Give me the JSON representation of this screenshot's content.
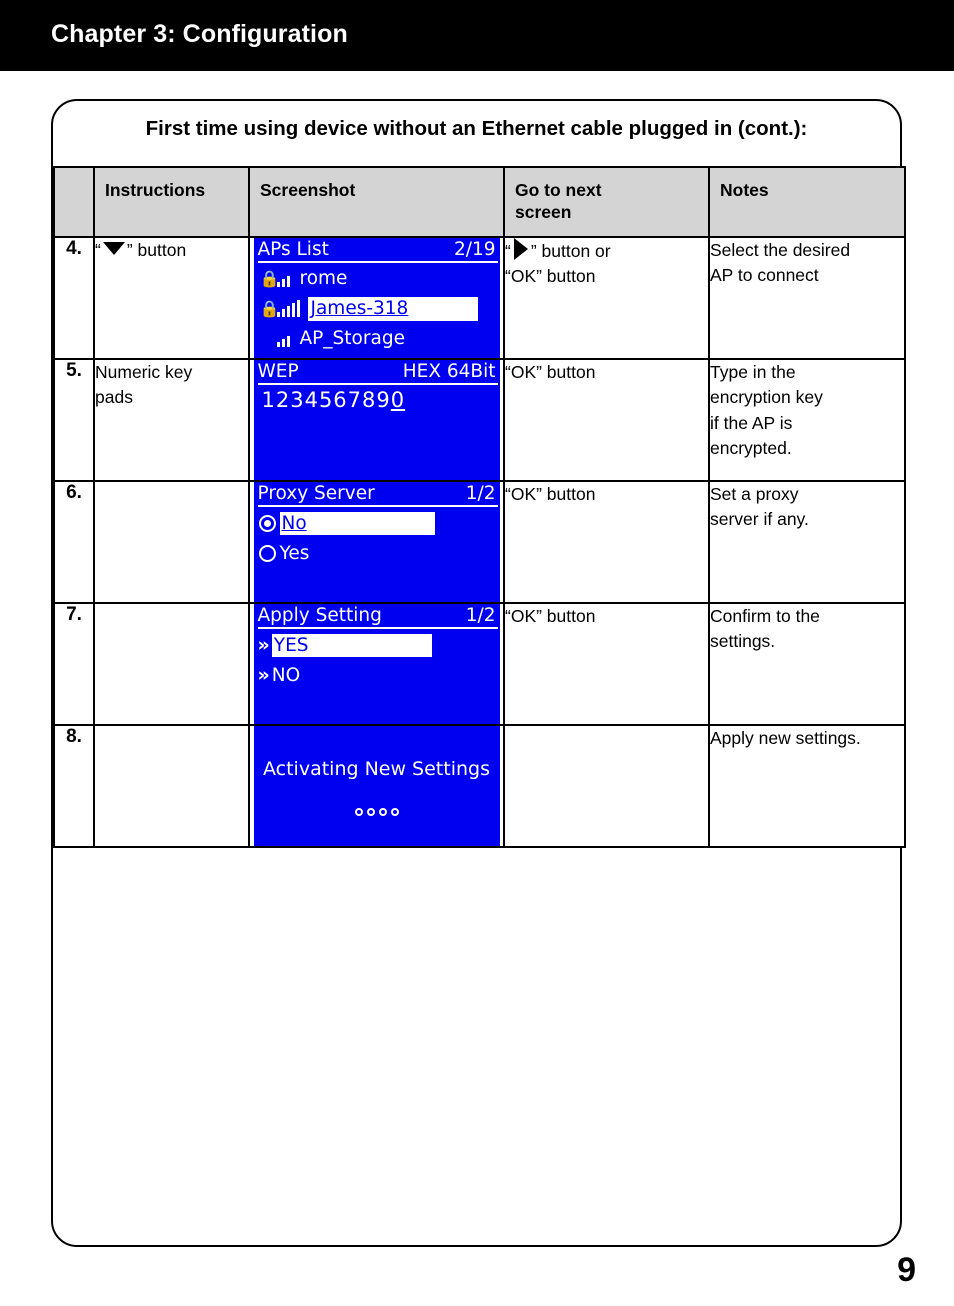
{
  "header": {
    "chapter_title": "Chapter 3: Configuration",
    "bar_color": "#000000"
  },
  "panel": {
    "heading": "First time using device without an Ethernet cable plugged in (cont.):"
  },
  "table": {
    "columns": [
      "",
      "Instructions",
      "Screenshot",
      "Go to next screen",
      "Notes"
    ],
    "header_bg": "#d4d4d4",
    "rows": [
      {
        "number": "4.",
        "instructions_pre": "“",
        "instructions_icon": "triangle-down-icon",
        "instructions_post": "” button",
        "next_pre": "“",
        "next_icon": "triangle-right-icon",
        "next_post": "” button or",
        "next_line2": "“OK” button",
        "notes_line1": "Select the desired",
        "notes_line2": "AP to connect",
        "screen": {
          "kind": "ap-list",
          "title_left": "APs List",
          "title_right": "2/19",
          "items": [
            {
              "lock": true,
              "bars": 3,
              "label": "rome",
              "selected": false
            },
            {
              "lock": true,
              "bars": 5,
              "label": "James-318",
              "selected": true
            },
            {
              "lock": false,
              "bars": 3,
              "label": "AP_Storage",
              "selected": false
            }
          ]
        }
      },
      {
        "number": "5.",
        "instructions_line1": "Numeric key",
        "instructions_line2": "pads",
        "next_line1": "“OK” button",
        "notes_line1": "Type in the",
        "notes_line2": "encryption key",
        "notes_line3": "if the AP is",
        "notes_line4": "encrypted.",
        "screen": {
          "kind": "wep-key",
          "title_left": "WEP",
          "title_right": "HEX 64Bit",
          "key_value": "123456789",
          "key_cursor": "0"
        }
      },
      {
        "number": "6.",
        "next_line1": "“OK” button",
        "notes_line1": "Set a proxy",
        "notes_line2": "server if any.",
        "screen": {
          "kind": "radio-list",
          "title_left": "Proxy Server",
          "title_right": "1/2",
          "options": [
            {
              "label": "No",
              "checked": true,
              "selected": true
            },
            {
              "label": "Yes",
              "checked": false,
              "selected": false
            }
          ]
        }
      },
      {
        "number": "7.",
        "next_line1": "“OK” button",
        "notes_line1": "Confirm to the",
        "notes_line2": "settings.",
        "screen": {
          "kind": "chevron-list",
          "title_left": "Apply Setting",
          "title_right": "1/2",
          "chevron_glyph": "»",
          "options": [
            {
              "label": "YES",
              "selected": true
            },
            {
              "label": "NO",
              "selected": false
            }
          ]
        }
      },
      {
        "number": "8.",
        "notes_line1": "Apply new settings.",
        "screen": {
          "kind": "progress",
          "message": "Activating New Settings",
          "dots": 4
        }
      }
    ]
  },
  "footer": {
    "page_number": "9"
  },
  "colors": {
    "lcd_background": "#0000f0",
    "lcd_foreground": "#ffffff",
    "header_bar": "#000000",
    "table_header": "#d4d4d4"
  }
}
